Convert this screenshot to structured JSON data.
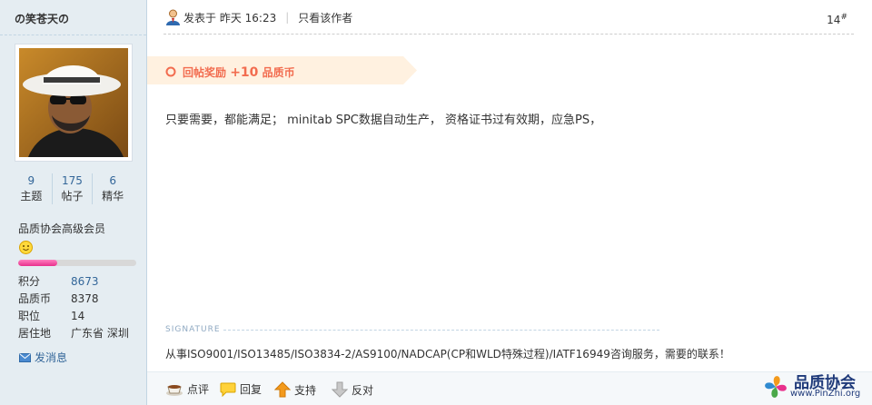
{
  "user": {
    "name": "の笑苍天の",
    "stats": [
      {
        "value": "9",
        "label": "主题"
      },
      {
        "value": "175",
        "label": "帖子"
      },
      {
        "value": "6",
        "label": "精华"
      }
    ],
    "group": "品质协会高级会员",
    "rank_progress": 0.33,
    "info": [
      {
        "key": "积分",
        "value": "8673"
      },
      {
        "key": "品质币",
        "value": "8378"
      },
      {
        "key": "职位",
        "value": "14"
      },
      {
        "key": "居住地",
        "value": "广东省 深圳"
      }
    ],
    "send_message": "发消息"
  },
  "post": {
    "posted_label": "发表于 昨天 16:23",
    "separator": "|",
    "author_only": "只看该作者",
    "floor_number": "14",
    "floor_mark": "#",
    "reward_label": "回帖奖励",
    "reward_amount": "+10",
    "reward_unit": "品质币",
    "content": "只要需要，都能满足； minitab  SPC数据自动生产，  资格证书过有效期，应急PS，",
    "signature_label": "SIGNATURE",
    "signature": "从事ISO9001/ISO13485/ISO3834-2/AS9100/NADCAP(CP和WLD特殊过程)/IATF16949咨询服务，需要的联系！"
  },
  "actions": {
    "comment": "点评",
    "reply": "回复",
    "support": "支持",
    "oppose": "反对"
  },
  "logo": {
    "name": "品质协会",
    "url": "www.PinZhi.org"
  },
  "colors": {
    "sidebar_bg": "#e5edf2",
    "link": "#336699",
    "reward": "#f26c4f",
    "rank_fill": "#e8308c"
  }
}
